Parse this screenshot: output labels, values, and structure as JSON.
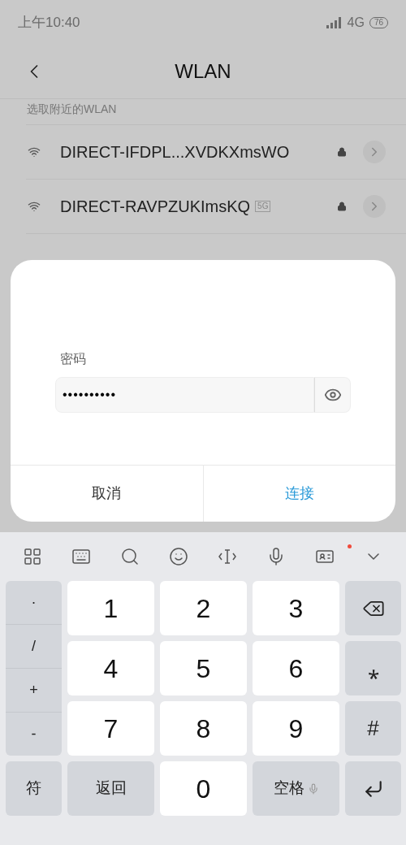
{
  "status_bar": {
    "time": "上午10:40",
    "network": "4G",
    "battery": "76"
  },
  "header": {
    "title": "WLAN"
  },
  "section_label": "选取附近的WLAN",
  "networks": [
    {
      "name": "DIRECT-IFDPL...XVDKXmsWO",
      "locked": true
    },
    {
      "name": "DIRECT-RAVPZUKImsKQ",
      "band": "5G",
      "locked": true
    }
  ],
  "dialog": {
    "password_label": "密码",
    "password_value": "••••••••••",
    "buttons": [
      {
        "label": "取消",
        "kind": "cancel"
      },
      {
        "label": "连接",
        "kind": "primary"
      }
    ]
  },
  "keyboard": {
    "toolbar": [
      {
        "kind": "grid",
        "notification": false
      },
      {
        "kind": "keyboard",
        "notification": false
      },
      {
        "kind": "search",
        "notification": false
      },
      {
        "kind": "emoji",
        "notification": false
      },
      {
        "kind": "cursor",
        "notification": false
      },
      {
        "kind": "mic",
        "notification": false
      },
      {
        "kind": "card",
        "notification": true
      },
      {
        "kind": "collapse",
        "notification": false
      }
    ],
    "symbols": [
      "·",
      "/",
      "+",
      "-"
    ],
    "digits": [
      [
        "1",
        "2",
        "3"
      ],
      [
        "4",
        "5",
        "6"
      ],
      [
        "7",
        "8",
        "9"
      ]
    ],
    "right_keys": [
      {
        "kind": "backspace"
      },
      {
        "kind": "text",
        "label": "⁎"
      },
      {
        "kind": "text",
        "label": "#"
      }
    ],
    "bottom": {
      "symbols_key": "符",
      "back_key": "返回",
      "zero": "0",
      "space": "空格"
    }
  }
}
